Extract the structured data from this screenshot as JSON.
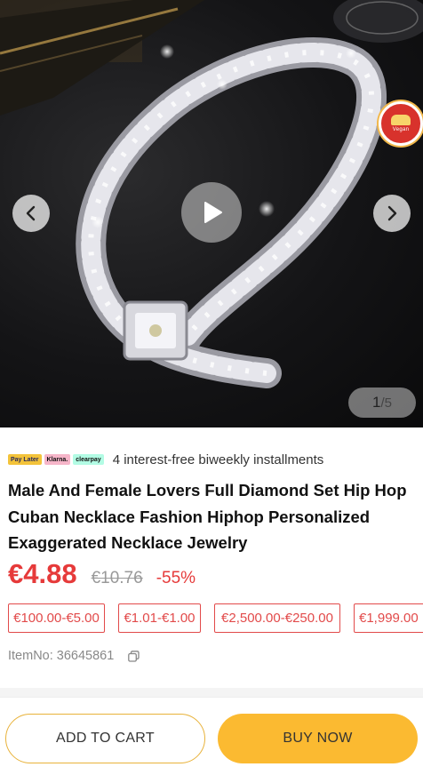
{
  "gallery": {
    "counter_current": "1",
    "counter_total": "/5",
    "icons": [
      "chevron-left-icon",
      "chevron-right-icon",
      "play-icon"
    ],
    "badge_text": "Vegan"
  },
  "installments": {
    "providers": [
      "Pay Later",
      "Klarna.",
      "clearpay"
    ],
    "text": "4 interest-free biweekly installments"
  },
  "product": {
    "title": "Male And Female Lovers Full Diamond Set Hip Hop Cuban Necklace Fashion Hiphop Personalized Exaggerated Necklace Jewelry",
    "price": "€4.88",
    "original_price": "€10.76",
    "discount": "-55%",
    "item_no": "ItemNo: 36645861"
  },
  "coupons": [
    "€100.00-€5.00",
    "€1.01-€1.00",
    "€2,500.00-€250.00",
    "€1,999.00"
  ],
  "actions": {
    "add_to_cart": "ADD TO CART",
    "buy_now": "BUY NOW"
  },
  "colors": {
    "price_red": "#e63a3a",
    "accent_yellow": "#fbba31",
    "coupon_border": "#e24a4a"
  }
}
